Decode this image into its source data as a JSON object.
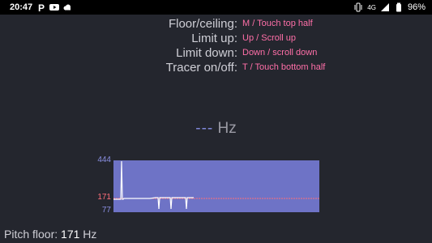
{
  "status_bar": {
    "time": "20:47",
    "left_icons": [
      "parking-icon",
      "youtube-icon",
      "cloud-icon"
    ],
    "network": "4G",
    "battery": "96%"
  },
  "help": [
    {
      "action": "Floor/ceiling:",
      "keys": "M / Touch top half"
    },
    {
      "action": "Limit up:",
      "keys": "Up / Scroll up"
    },
    {
      "action": "Limit down:",
      "keys": "Down / scroll down"
    },
    {
      "action": "Tracer on/off:",
      "keys": "T / Touch bottom half"
    }
  ],
  "pitch": {
    "value": "---",
    "unit": "Hz"
  },
  "graph": {
    "axis_top": "444",
    "axis_floor": "171",
    "axis_bottom": "77",
    "colors": {
      "background": "#6e73c6",
      "floor_line": "#ff6f7a",
      "trace": "#ffffff"
    }
  },
  "floor": {
    "label": "Pitch floor:",
    "value": "171",
    "unit": "Hz"
  }
}
